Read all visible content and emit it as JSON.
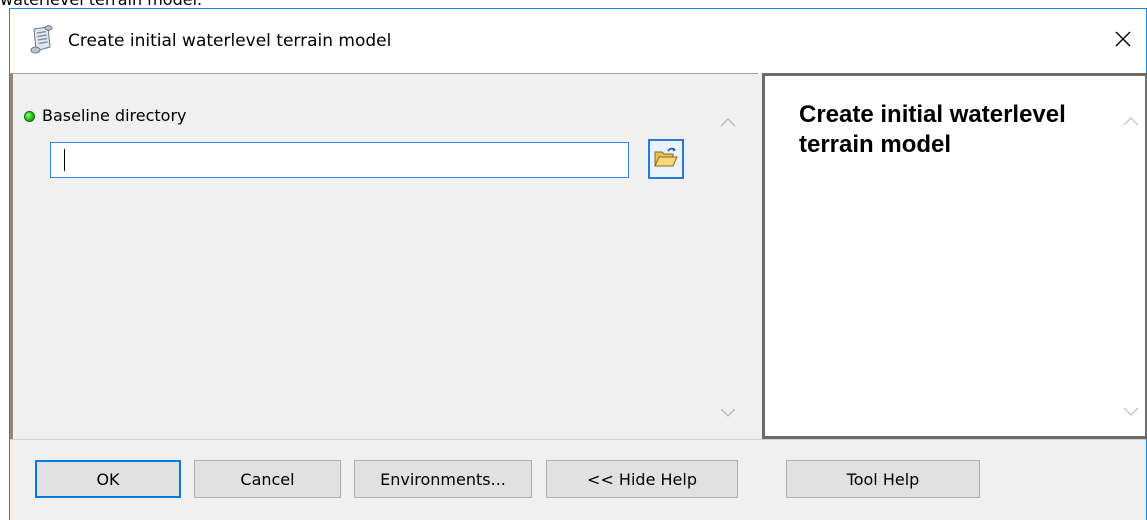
{
  "page_caption": "waterlevel terrain model.",
  "window": {
    "title": "Create initial waterlevel terrain model"
  },
  "parameters": {
    "baseline_label": "Baseline directory",
    "baseline_value": ""
  },
  "help": {
    "title": "Create initial waterlevel terrain model"
  },
  "buttons": {
    "ok": "OK",
    "cancel": "Cancel",
    "environments": "Environments...",
    "hide_help": "<< Hide Help",
    "tool_help": "Tool Help"
  },
  "icons": {
    "title": "toolbox-script-icon",
    "close": "close-icon",
    "browse": "open-folder-icon",
    "required": "required-parameter-dot-icon"
  },
  "colors": {
    "accent": "#0078d7",
    "required_green": "#1fbf1f",
    "pane_background": "#f0f0f0"
  }
}
